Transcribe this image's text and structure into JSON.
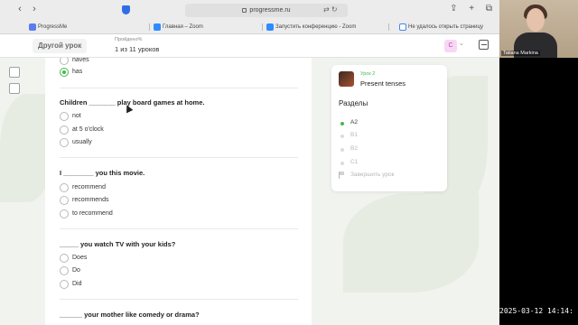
{
  "browser": {
    "url": "progressme.ru",
    "tabs": [
      {
        "label": "ProgressMe",
        "color": "#5b7cf0"
      },
      {
        "label": "Главная – Zoom",
        "color": "#2d8cff"
      },
      {
        "label": "Запустить конференцию - Zoom",
        "color": "#2d8cff"
      },
      {
        "label": "Не удалось открыть страницу",
        "color": "#4285f4"
      }
    ]
  },
  "header": {
    "other_lesson": "Другой урок",
    "passed": "Пройдено%",
    "lesson_count": "1 из 11 уроков",
    "user_initial": "C"
  },
  "questions": [
    {
      "title": "",
      "options": [
        {
          "label": "haves",
          "checked": false
        },
        {
          "label": "has",
          "checked": true
        }
      ]
    },
    {
      "title": "Children _______ play board games at home.",
      "options": [
        {
          "label": "not",
          "checked": false
        },
        {
          "label": "at 5 o'clock",
          "checked": false
        },
        {
          "label": "usually",
          "checked": false
        }
      ]
    },
    {
      "title": "I ________ you this movie.",
      "options": [
        {
          "label": "recommend",
          "checked": false
        },
        {
          "label": "recommends",
          "checked": false
        },
        {
          "label": "to recommend",
          "checked": false
        }
      ]
    },
    {
      "title": "_____ you watch TV with your kids?",
      "options": [
        {
          "label": "Does",
          "checked": false
        },
        {
          "label": "Do",
          "checked": false
        },
        {
          "label": "Did",
          "checked": false
        }
      ]
    },
    {
      "title": "______ your mother like comedy or drama?",
      "options": []
    }
  ],
  "panel": {
    "lesson_num": "Урок 2",
    "lesson_name": "Present tenses",
    "sections_title": "Разделы",
    "sections": [
      {
        "label": "A2",
        "active": true
      },
      {
        "label": "B1",
        "active": false
      },
      {
        "label": "B2",
        "active": false
      },
      {
        "label": "C1",
        "active": false
      }
    ],
    "finish": "Завершить урок"
  },
  "webcam": {
    "name": "Tatiana Markina"
  },
  "timestamp": "2025-03-12 14:14:"
}
